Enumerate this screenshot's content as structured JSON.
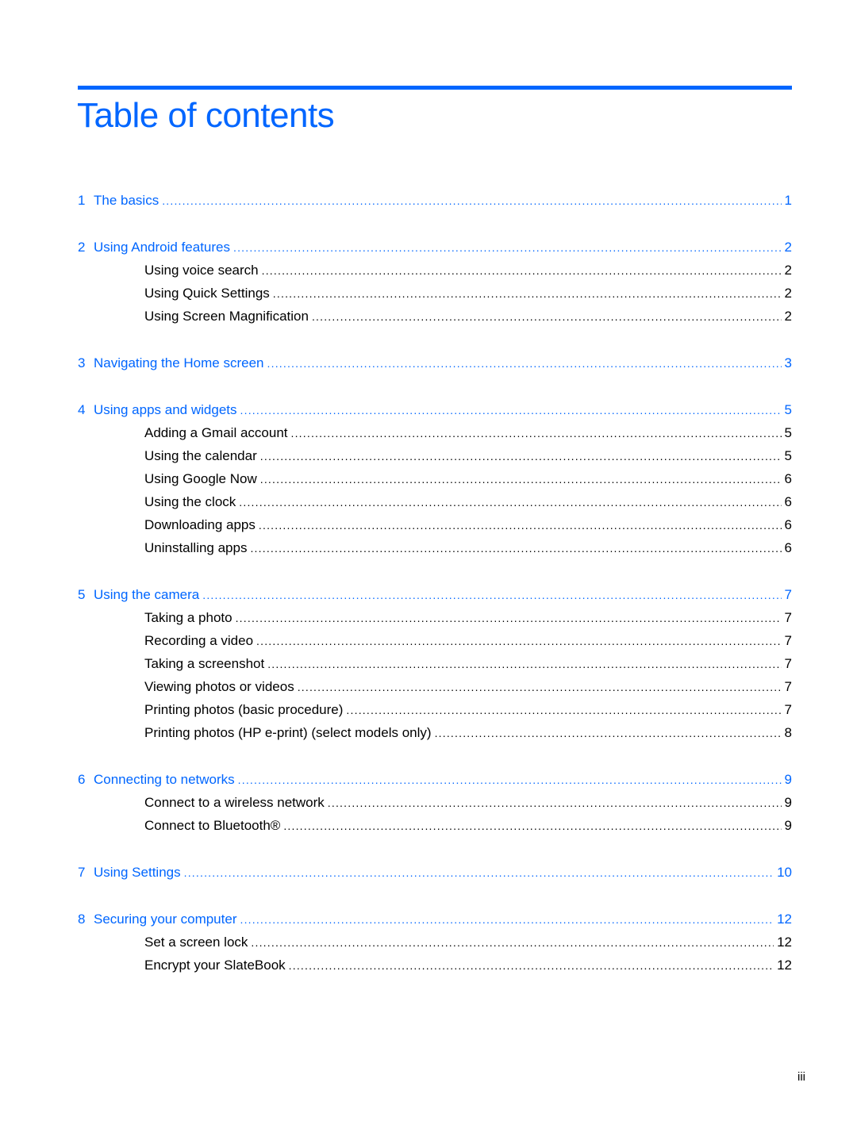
{
  "document": {
    "title": "Table of contents",
    "accent_color": "#0066ff",
    "page_number": "iii"
  },
  "chapters": [
    {
      "number": "1",
      "title": "The basics",
      "page": "1",
      "sections": []
    },
    {
      "number": "2",
      "title": "Using Android features",
      "page": "2",
      "sections": [
        {
          "title": "Using voice search",
          "page": "2"
        },
        {
          "title": "Using Quick Settings",
          "page": "2"
        },
        {
          "title": "Using Screen Magnification",
          "page": "2"
        }
      ]
    },
    {
      "number": "3",
      "title": "Navigating the Home screen",
      "page": "3",
      "sections": []
    },
    {
      "number": "4",
      "title": "Using apps and widgets",
      "page": "5",
      "sections": [
        {
          "title": "Adding a Gmail account",
          "page": "5"
        },
        {
          "title": "Using the calendar",
          "page": "5"
        },
        {
          "title": "Using Google Now",
          "page": "6"
        },
        {
          "title": "Using the clock",
          "page": "6"
        },
        {
          "title": "Downloading apps",
          "page": "6"
        },
        {
          "title": "Uninstalling apps",
          "page": "6"
        }
      ]
    },
    {
      "number": "5",
      "title": "Using the camera",
      "page": "7",
      "sections": [
        {
          "title": "Taking a photo",
          "page": "7"
        },
        {
          "title": "Recording a video",
          "page": "7"
        },
        {
          "title": "Taking a screenshot",
          "page": "7"
        },
        {
          "title": "Viewing photos or videos",
          "page": "7"
        },
        {
          "title": "Printing photos (basic procedure)",
          "page": "7"
        },
        {
          "title": "Printing photos (HP e-print) (select models only)",
          "page": "8"
        }
      ]
    },
    {
      "number": "6",
      "title": "Connecting to networks",
      "page": "9",
      "sections": [
        {
          "title": "Connect to a wireless network",
          "page": "9"
        },
        {
          "title": "Connect to Bluetooth®",
          "page": "9"
        }
      ]
    },
    {
      "number": "7",
      "title": "Using Settings",
      "page": "10",
      "sections": []
    },
    {
      "number": "8",
      "title": "Securing your computer",
      "page": "12",
      "sections": [
        {
          "title": "Set a screen lock",
          "page": "12"
        },
        {
          "title": "Encrypt your SlateBook",
          "page": "12"
        }
      ]
    }
  ]
}
